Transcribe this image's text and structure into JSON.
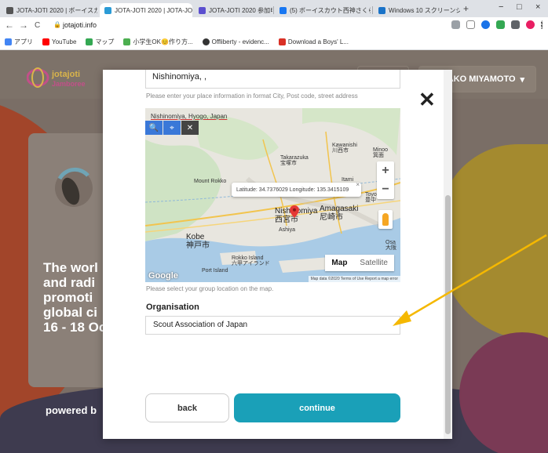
{
  "browser": {
    "tabs": [
      {
        "label": "JOTA-JOTI 2020 | ボーイスカ",
        "favicon_color": "#555555"
      },
      {
        "label": "JOTA-JOTI 2020 | JOTA-JO",
        "favicon_color": "#2b9bd6"
      },
      {
        "label": "JOTA-JOTI 2020 参加申込",
        "favicon_color": "#5b4fcf"
      },
      {
        "label": "(5) ボーイスカウト西神さくら",
        "favicon_color": "#1877f2"
      },
      {
        "label": "Windows 10 スクリーンショ",
        "favicon_color": "#1a73c8"
      }
    ],
    "close_glyph": "×",
    "new_tab_glyph": "+",
    "window_controls": [
      "−",
      "□",
      "×"
    ],
    "url": "jotajoti.info",
    "nav_glyphs": {
      "back": "←",
      "forward": "→",
      "reload": "C",
      "lock": "🔒"
    },
    "bookmarks": [
      {
        "label": "アプリ",
        "color": "#4285f4"
      },
      {
        "label": "YouTube",
        "color": "#ff0000"
      },
      {
        "label": "マップ",
        "color": "#34a853"
      },
      {
        "label": "小学生OK😊作り方...",
        "color": "#4caf50"
      },
      {
        "label": "Offliberty - evidenc...",
        "color": "#333333"
      },
      {
        "label": "Download a Boys' L...",
        "color": "#d93025"
      }
    ]
  },
  "page": {
    "logo_text": [
      "jotajoti",
      "Jamboree"
    ],
    "user_name": "TAKAKO MIYAMOTO",
    "user_caret": "▾",
    "promo_lines": "The worl\nand radi\npromoti\nglobal ci\n16 - 18 Oc",
    "powered_by": "powered b"
  },
  "modal": {
    "close_glyph": "✕",
    "place_value": "Nishinomiya, ,",
    "place_hint": "Please enter your place information in format City, Post code, street address",
    "map": {
      "search_text": "Nishinomiya, Hyogo, Japan",
      "tool_icons": [
        "🔍",
        "⌖",
        "✕"
      ],
      "zoom_in": "+",
      "zoom_out": "−",
      "info_text": "Latitude: 34.7376029 Longitude: 135.3415109",
      "info_close": "×",
      "map_type_map": "Map",
      "map_type_satellite": "Satellite",
      "google_logo": "Google",
      "attribution": "Map data ©2020   Terms of Use   Report a map error",
      "labels": {
        "kawanishi": "Kawanishi\n川西市",
        "minoo": "Minoo\n箕面",
        "takarazuka": "Takarazuka\n宝塚市",
        "mount_rokko": "Mount Rokko",
        "itami": "Itami",
        "toyonaka": "Toyo\n豊中",
        "nishinomiya": "Nishinomiya\n西宮市",
        "amagasaki": "Amagasaki\n尼崎市",
        "ashiya": "Ashiya",
        "kobe": "Kobe\n神戸市",
        "rokko_island": "Rokko Island\n六甲アイランド",
        "port_island": "Port Island",
        "osaka": "Osa\n大阪"
      }
    },
    "map_hint": "Please select your group location on the map.",
    "organisation_label": "Organisation",
    "organisation_value": "Scout Association of Japan",
    "back_label": "back",
    "continue_label": "continue"
  },
  "colors": {
    "accent": "#1aa0b8",
    "annotation_arrow": "#f5b800",
    "marker": "#e53935"
  }
}
